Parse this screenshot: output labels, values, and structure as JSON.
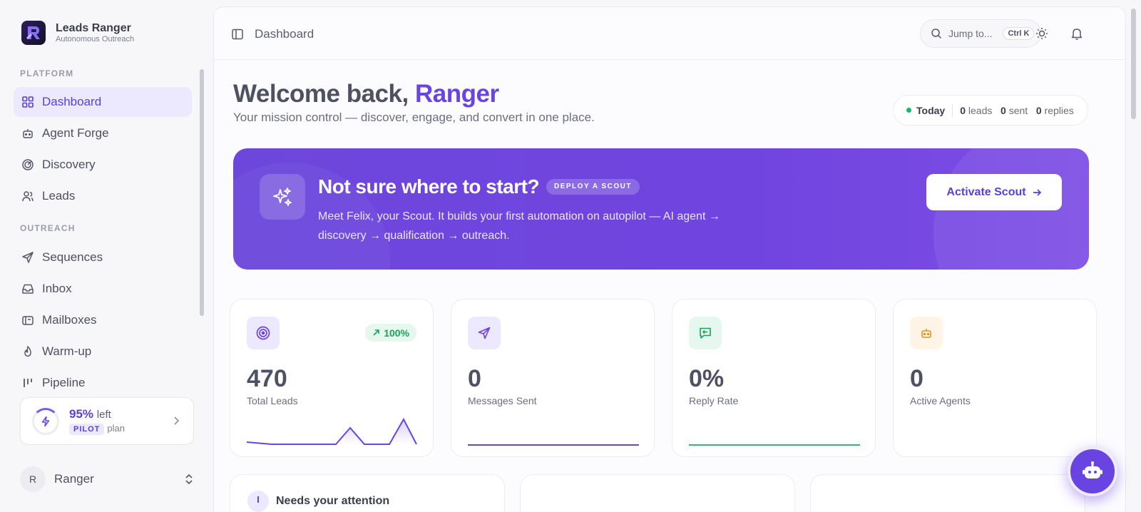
{
  "brand": {
    "name": "Leads Ranger",
    "tagline": "Autonomous Outreach"
  },
  "sidebar": {
    "sections": [
      {
        "label": "PLATFORM"
      },
      {
        "label": "OUTREACH"
      }
    ],
    "items": [
      {
        "label": "Dashboard",
        "icon": "grid-icon",
        "active": true
      },
      {
        "label": "Agent Forge",
        "icon": "robot-icon"
      },
      {
        "label": "Discovery",
        "icon": "radar-icon"
      },
      {
        "label": "Leads",
        "icon": "users-icon"
      },
      {
        "label": "Sequences",
        "icon": "send-icon"
      },
      {
        "label": "Inbox",
        "icon": "inbox-icon"
      },
      {
        "label": "Mailboxes",
        "icon": "mailbox-icon"
      },
      {
        "label": "Warm-up",
        "icon": "flame-icon"
      },
      {
        "label": "Pipeline",
        "icon": "pipeline-icon"
      }
    ],
    "plan": {
      "percent": "95%",
      "left_label": "left",
      "tier": "PILOT",
      "plan_label": "plan",
      "remaining_fraction": 0.95
    },
    "user": {
      "initial": "R",
      "name": "Ranger"
    }
  },
  "topbar": {
    "breadcrumb": "Dashboard",
    "search": {
      "placeholder": "Jump to...",
      "shortcut": "Ctrl K"
    }
  },
  "header": {
    "welcome_prefix": "Welcome back, ",
    "welcome_name": "Ranger",
    "subtitle": "Your mission control — discover, engage, and convert in one place."
  },
  "today": {
    "label": "Today",
    "leads_value": "0",
    "leads_label": "leads",
    "sent_value": "0",
    "sent_label": "sent",
    "replies_value": "0",
    "replies_label": "replies"
  },
  "hero": {
    "title": "Not sure where to start?",
    "badge": "DEPLOY A SCOUT",
    "description": "Meet Felix, your Scout. It builds your first automation on autopilot — AI agent → discovery → qualification → outreach.",
    "button": "Activate Scout"
  },
  "stats": [
    {
      "value": "470",
      "label": "Total Leads",
      "trend": "100%",
      "icon": "target-icon"
    },
    {
      "value": "0",
      "label": "Messages Sent",
      "icon": "send-icon"
    },
    {
      "value": "0%",
      "label": "Reply Rate",
      "icon": "reply-icon"
    },
    {
      "value": "0",
      "label": "Active Agents",
      "icon": "robot-icon"
    }
  ],
  "bottom_cards": [
    {
      "title": "Needs your attention"
    },
    {
      "title": ""
    },
    {
      "title": ""
    }
  ],
  "colors": {
    "accent": "#6a44e0",
    "accent_soft": "#ece8fd",
    "success": "#16b86b",
    "warning_soft": "#fff4e5"
  }
}
